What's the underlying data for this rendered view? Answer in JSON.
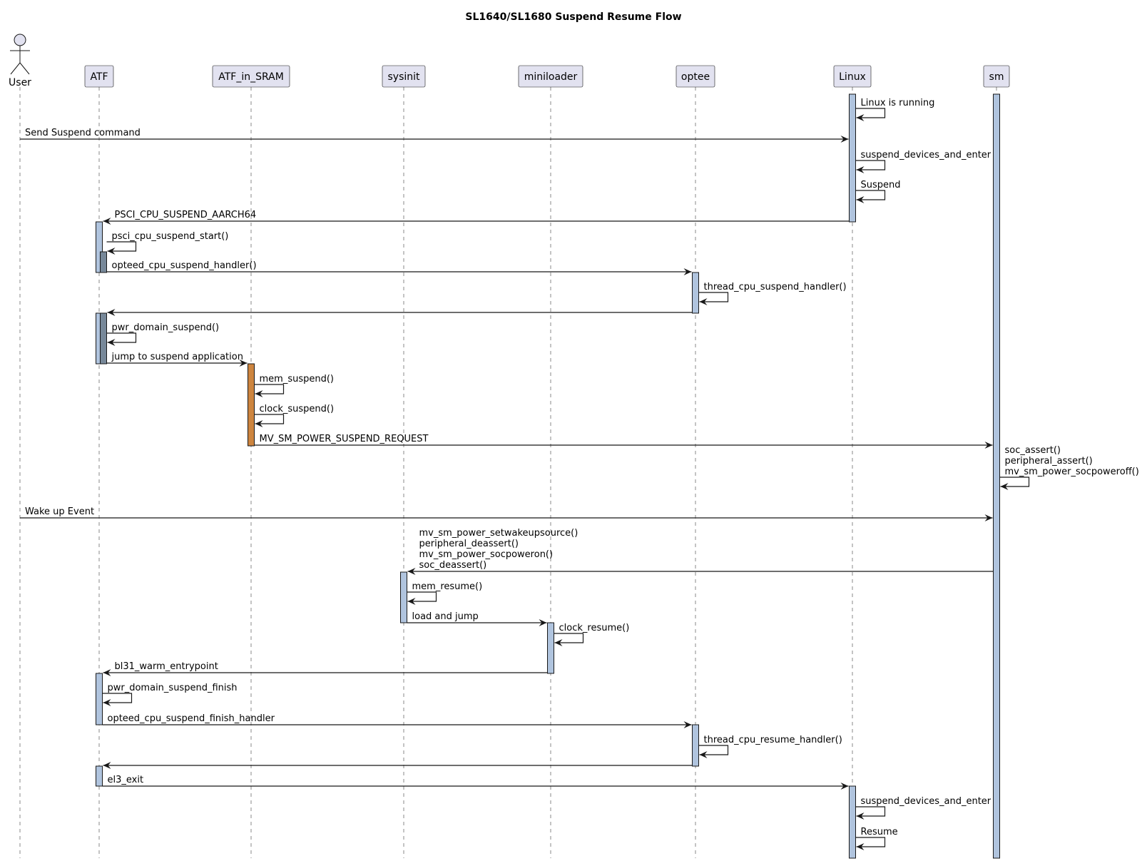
{
  "title": "SL1640/SL1680 Suspend Resume Flow",
  "colors": {
    "participant_fill": "#E2E2F0",
    "activation_blue": "#B0C4DE",
    "activation_slate": "#778899",
    "activation_orange": "#CD853F",
    "line": "#181818",
    "lifeline": "#888888"
  },
  "participants": [
    {
      "id": "user",
      "label": "User",
      "kind": "actor"
    },
    {
      "id": "atf",
      "label": "ATF",
      "kind": "box"
    },
    {
      "id": "atfsram",
      "label": "ATF_in_SRAM",
      "kind": "box"
    },
    {
      "id": "sysinit",
      "label": "sysinit",
      "kind": "box"
    },
    {
      "id": "miniloader",
      "label": "miniloader",
      "kind": "box"
    },
    {
      "id": "optee",
      "label": "optee",
      "kind": "box"
    },
    {
      "id": "linux",
      "label": "Linux",
      "kind": "box"
    },
    {
      "id": "sm",
      "label": "sm",
      "kind": "box"
    }
  ],
  "messages": [
    {
      "from": "linux",
      "to": "linux",
      "lines": [
        "Linux is running"
      ]
    },
    {
      "from": "user",
      "to": "linux",
      "lines": [
        "Send Suspend command"
      ]
    },
    {
      "from": "linux",
      "to": "linux",
      "lines": [
        "suspend_devices_and_enter"
      ]
    },
    {
      "from": "linux",
      "to": "linux",
      "lines": [
        "Suspend"
      ]
    },
    {
      "from": "linux",
      "to": "atf",
      "lines": [
        "PSCI_CPU_SUSPEND_AARCH64"
      ]
    },
    {
      "from": "atf",
      "to": "atf",
      "lines": [
        "psci_cpu_suspend_start()"
      ]
    },
    {
      "from": "atf",
      "to": "optee",
      "lines": [
        "opteed_cpu_suspend_handler()"
      ]
    },
    {
      "from": "optee",
      "to": "optee",
      "lines": [
        "thread_cpu_suspend_handler()"
      ]
    },
    {
      "from": "optee",
      "to": "atf",
      "lines": []
    },
    {
      "from": "atf",
      "to": "atf",
      "lines": [
        "pwr_domain_suspend()"
      ]
    },
    {
      "from": "atf",
      "to": "atfsram",
      "lines": [
        "jump to suspend application"
      ]
    },
    {
      "from": "atfsram",
      "to": "atfsram",
      "lines": [
        "mem_suspend()"
      ]
    },
    {
      "from": "atfsram",
      "to": "atfsram",
      "lines": [
        "clock_suspend()"
      ]
    },
    {
      "from": "atfsram",
      "to": "sm",
      "lines": [
        "MV_SM_POWER_SUSPEND_REQUEST"
      ]
    },
    {
      "from": "sm",
      "to": "sm",
      "lines": [
        "soc_assert()",
        "peripheral_assert()",
        "mv_sm_power_socpoweroff()"
      ]
    },
    {
      "from": "user",
      "to": "sm",
      "lines": [
        "Wake up Event"
      ]
    },
    {
      "from": "sm",
      "to": "sysinit",
      "lines": [
        "mv_sm_power_setwakeupsource()",
        "peripheral_deassert()",
        "mv_sm_power_socpoweron()",
        "soc_deassert()"
      ]
    },
    {
      "from": "sysinit",
      "to": "sysinit",
      "lines": [
        "mem_resume()"
      ]
    },
    {
      "from": "sysinit",
      "to": "miniloader",
      "lines": [
        "load and jump"
      ]
    },
    {
      "from": "miniloader",
      "to": "miniloader",
      "lines": [
        "clock_resume()"
      ]
    },
    {
      "from": "miniloader",
      "to": "atf",
      "lines": [
        "bl31_warm_entrypoint"
      ]
    },
    {
      "from": "atf",
      "to": "atf",
      "lines": [
        "pwr_domain_suspend_finish"
      ]
    },
    {
      "from": "atf",
      "to": "optee",
      "lines": [
        "opteed_cpu_suspend_finish_handler"
      ]
    },
    {
      "from": "optee",
      "to": "optee",
      "lines": [
        "thread_cpu_resume_handler()"
      ]
    },
    {
      "from": "optee",
      "to": "atf",
      "lines": []
    },
    {
      "from": "atf",
      "to": "linux",
      "lines": [
        "el3_exit"
      ]
    },
    {
      "from": "linux",
      "to": "linux",
      "lines": [
        "suspend_devices_and_enter"
      ]
    },
    {
      "from": "linux",
      "to": "linux",
      "lines": [
        "Resume"
      ]
    }
  ]
}
